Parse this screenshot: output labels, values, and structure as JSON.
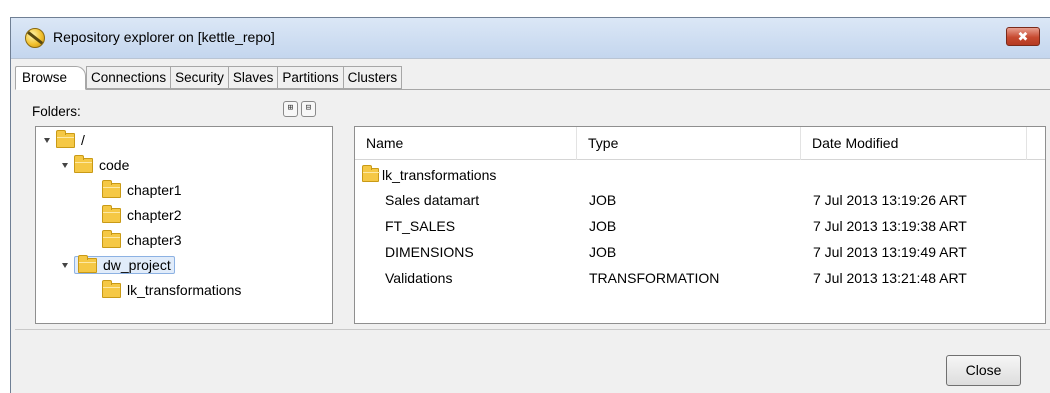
{
  "window": {
    "title": "Repository explorer on [kettle_repo]",
    "close_glyph": "✖"
  },
  "tabs": [
    {
      "label": "Browse",
      "active": true
    },
    {
      "label": "Connections"
    },
    {
      "label": "Security"
    },
    {
      "label": "Slaves"
    },
    {
      "label": "Partitions"
    },
    {
      "label": "Clusters"
    }
  ],
  "browse": {
    "folders_label": "Folders:",
    "toolbar_icons": [
      "expand-tree-icon",
      "collapse-tree-icon"
    ],
    "tree": [
      {
        "label": "/",
        "expanded": true
      },
      {
        "label": "code",
        "expanded": true
      },
      {
        "label": "chapter1"
      },
      {
        "label": "chapter2"
      },
      {
        "label": "chapter3"
      },
      {
        "label": "dw_project",
        "expanded": true,
        "selected": true
      },
      {
        "label": "lk_transformations"
      }
    ],
    "columns": {
      "name": "Name",
      "type": "Type",
      "date": "Date Modified"
    },
    "folder_row": {
      "name": "lk_transformations"
    },
    "rows": [
      {
        "name": "Sales datamart",
        "type": "JOB",
        "date": "7 Jul 2013 13:19:26 ART"
      },
      {
        "name": "FT_SALES",
        "type": "JOB",
        "date": "7 Jul 2013 13:19:38 ART"
      },
      {
        "name": "DIMENSIONS",
        "type": "JOB",
        "date": "7 Jul 2013 13:19:49 ART"
      },
      {
        "name": "Validations",
        "type": "TRANSFORMATION",
        "date": "7 Jul 2013 13:21:48 ART"
      }
    ]
  },
  "footer": {
    "close_label": "Close"
  },
  "colors": {
    "title_bg": "#c4d6ee",
    "folder": "#f5c845",
    "selection": "#e1ecfa"
  }
}
